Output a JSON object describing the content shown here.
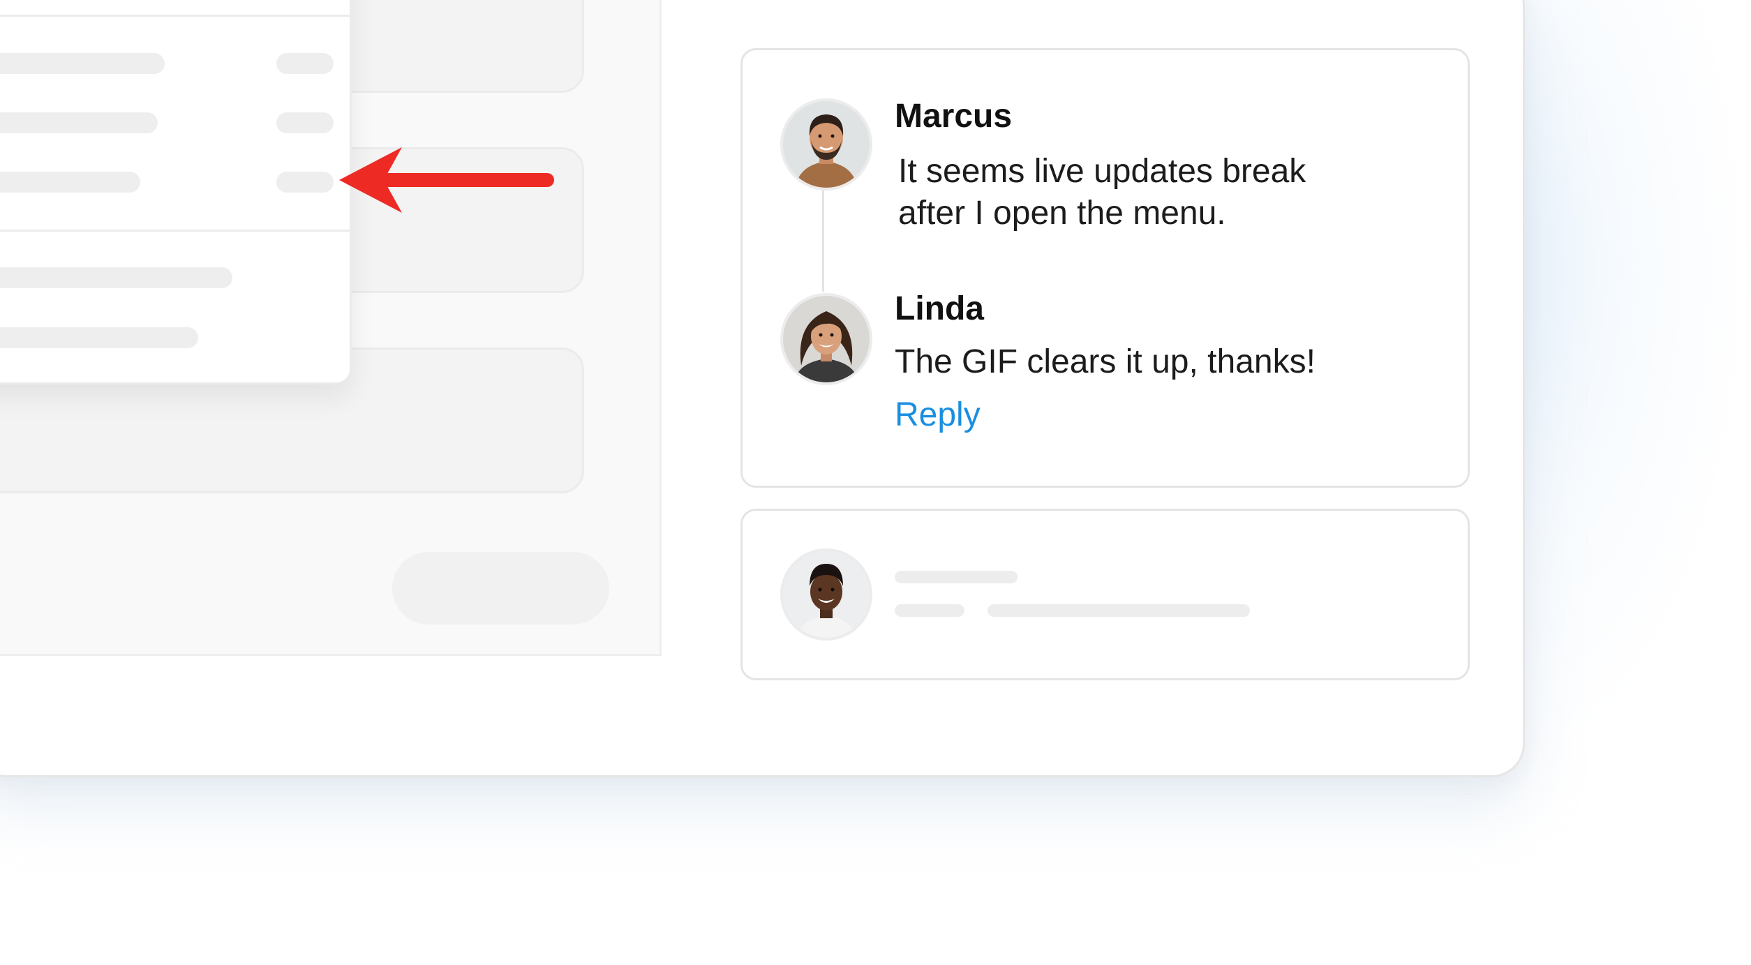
{
  "colors": {
    "accent_link": "#1a8fe0",
    "arrow": "#ee2a24",
    "skeleton": "#eeeeee"
  },
  "comments": {
    "items": [
      {
        "author": "Marcus",
        "message_lines": [
          "It seems live updates break",
          "after I open the menu."
        ],
        "avatar_icon": "marcus-avatar"
      },
      {
        "author": "Linda",
        "message_lines": [
          "The GIF clears it up, thanks!"
        ],
        "avatar_icon": "linda-avatar"
      }
    ],
    "reply_label": "Reply"
  },
  "placeholder_comment": {
    "avatar_icon": "user-avatar"
  },
  "annotation": {
    "icon": "arrow-left-icon"
  }
}
